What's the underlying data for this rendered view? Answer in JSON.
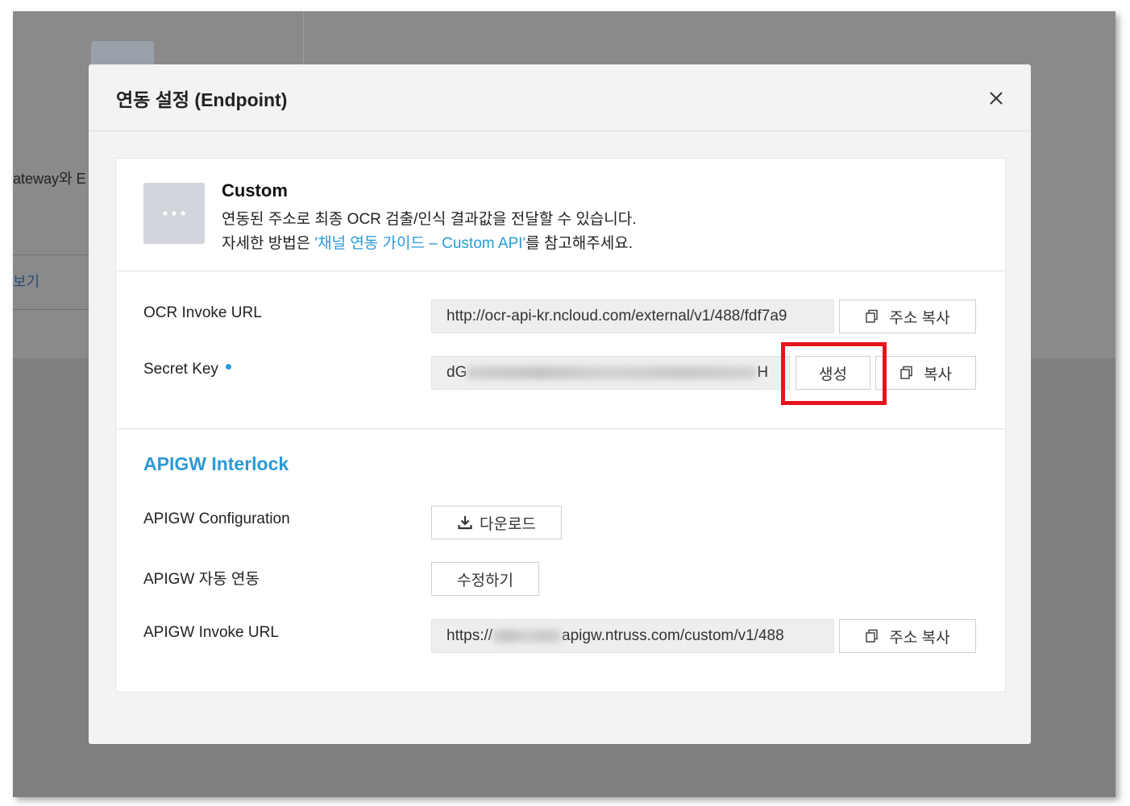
{
  "background": {
    "partial_text_1": "ateway와 E",
    "partial_text_2": "보기"
  },
  "modal": {
    "title": "연동 설정 (Endpoint)"
  },
  "custom": {
    "title": "Custom",
    "desc_line1": "연동된 주소로 최종 OCR 검출/인식 결과값을 전달할 수 있습니다.",
    "desc_line2_prefix": "자세한 방법은 ",
    "desc_line2_link": "'채널 연동 가이드 – Custom API'",
    "desc_line2_suffix": "를 참고해주세요."
  },
  "ocr_invoke_url": {
    "label": "OCR Invoke URL",
    "value": "http://ocr-api-kr.ncloud.com/external/v1/488/fdf7a9",
    "copy_label": "주소 복사"
  },
  "secret_key": {
    "label": "Secret Key",
    "value_start": "dG",
    "value_end": "H",
    "generate_label": "생성",
    "copy_label": "복사"
  },
  "apigw": {
    "section_title": "APIGW Interlock",
    "config_label": "APIGW Configuration",
    "download_label": "다운로드",
    "auto_label": "APIGW 자동 연동",
    "edit_label": "수정하기",
    "invoke_label": "APIGW Invoke URL",
    "invoke_value_prefix": "https://",
    "invoke_value_suffix": "apigw.ntruss.com/custom/v1/488",
    "copy_label": "주소 복사"
  },
  "colors": {
    "accent": "#2a9ad6",
    "highlight": "#e8141b",
    "overlay": "#7f7f7f"
  }
}
